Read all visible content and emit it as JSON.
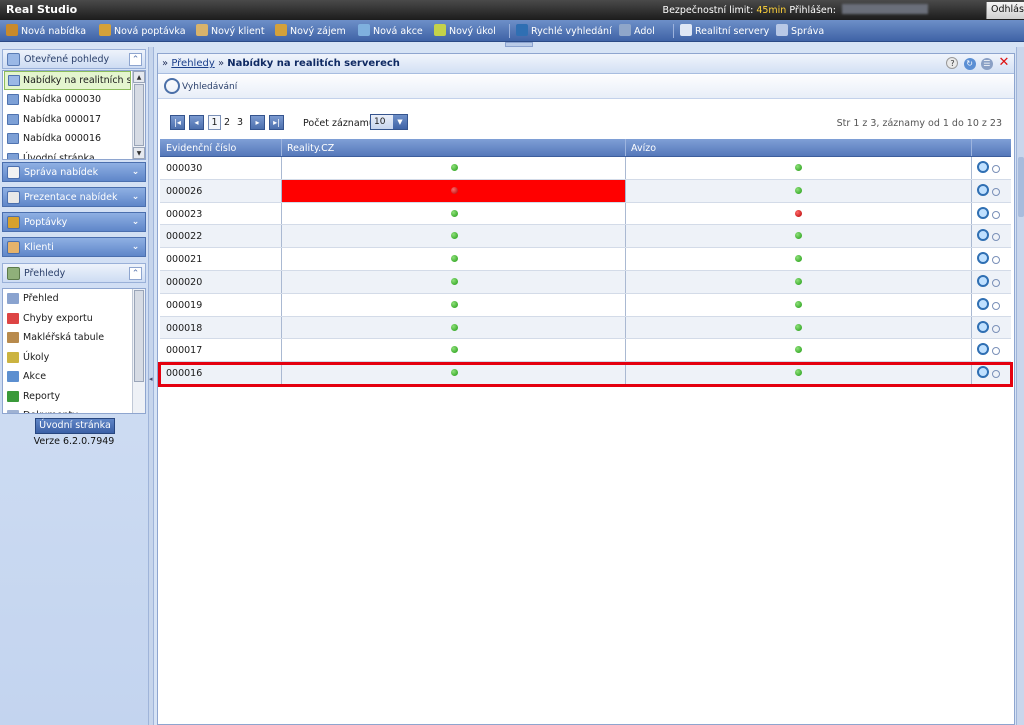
{
  "app": {
    "title": "Real Studio",
    "security_label": "Bezpečnostní limit:",
    "security_time": "45min",
    "logged_label": "Přihlášen:",
    "logout_label": "Odhlás"
  },
  "toolbar": {
    "items": [
      {
        "label": "Nová nabídka",
        "icon": "house-add-icon",
        "color": "#c98a2b"
      },
      {
        "label": "Nová poptávka",
        "icon": "house-query-icon",
        "color": "#d4a13a"
      },
      {
        "label": "Nový klient",
        "icon": "people-icon",
        "color": "#d9b36b"
      },
      {
        "label": "Nový zájem",
        "icon": "key-icon",
        "color": "#d4a13a"
      },
      {
        "label": "Nová akce",
        "icon": "calendar-add-icon",
        "color": "#7fb0de"
      },
      {
        "label": "Nový úkol",
        "icon": "task-add-icon",
        "color": "#c4d24a"
      },
      {
        "label": "Rychlé vyhledání",
        "icon": "search-icon",
        "color": "#2f6fb3"
      },
      {
        "label": "Adol",
        "icon": "gear-icon",
        "color": "#8fa6c9"
      },
      {
        "label": "Realitní servery",
        "icon": "server-icon",
        "color": "#dfe7f5"
      },
      {
        "label": "Správa",
        "icon": "settings-icon",
        "color": "#b8c8e6"
      }
    ]
  },
  "sidebar": {
    "open_views": {
      "header": "Otevřené pohledy",
      "items": [
        {
          "label": "Nabídky na realitních serv",
          "selected": true
        },
        {
          "label": "Nabídka 000030"
        },
        {
          "label": "Nabídka 000017"
        },
        {
          "label": "Nabídka 000016"
        },
        {
          "label": "Úvodní stránka"
        }
      ]
    },
    "sections": [
      {
        "label": "Správa nabídek",
        "icon": "house-icon",
        "color": "#f2f2f2"
      },
      {
        "label": "Prezentace nabídek",
        "icon": "presentation-icon",
        "color": "#e8e8e8"
      },
      {
        "label": "Poptávky",
        "icon": "query-icon",
        "color": "#d7a12e"
      },
      {
        "label": "Klienti",
        "icon": "clients-icon",
        "color": "#e6b36b"
      }
    ],
    "overviews": {
      "header": "Přehledy",
      "items": [
        {
          "label": "Přehled",
          "icon": "overview-icon",
          "color": "#8aa3cf"
        },
        {
          "label": "Chyby exportu",
          "icon": "export-error-icon",
          "color": "#d44"
        },
        {
          "label": "Makléřská tabule",
          "icon": "board-icon",
          "color": "#b88a4c"
        },
        {
          "label": "Úkoly",
          "icon": "tasks-icon",
          "color": "#cbb340"
        },
        {
          "label": "Akce",
          "icon": "actions-icon",
          "color": "#5c8fd0"
        },
        {
          "label": "Reporty",
          "icon": "reports-icon",
          "color": "#3a9a3a"
        },
        {
          "label": "Dokumenty",
          "icon": "documents-icon",
          "color": "#9fb2d3"
        }
      ]
    },
    "home_button": "Úvodní stránka",
    "version": "Verze 6.2.0.7949"
  },
  "main": {
    "breadcrumb_prefix": "»",
    "breadcrumb_link": "Přehledy",
    "breadcrumb_sep": "»",
    "title": "Nabídky na realitích serverech",
    "search_label": "Vyhledávání",
    "pager": {
      "pages": [
        "1",
        "2",
        "3"
      ],
      "current": "1",
      "records_label": "Počet záznamů",
      "records_value": "10",
      "info": "Str 1 z 3, záznamy od 1 do 10 z 23"
    },
    "grid": {
      "columns": [
        "Evidenční číslo",
        "Reality.CZ",
        "Avízo",
        ""
      ],
      "rows": [
        {
          "id": "000030",
          "reality": "ok",
          "avizo": "ok"
        },
        {
          "id": "000026",
          "reality": "error",
          "avizo": "ok"
        },
        {
          "id": "000023",
          "reality": "ok",
          "avizo": "error"
        },
        {
          "id": "000022",
          "reality": "ok",
          "avizo": "ok"
        },
        {
          "id": "000021",
          "reality": "ok",
          "avizo": "ok"
        },
        {
          "id": "000020",
          "reality": "ok",
          "avizo": "ok"
        },
        {
          "id": "000019",
          "reality": "ok",
          "avizo": "ok"
        },
        {
          "id": "000018",
          "reality": "ok",
          "avizo": "ok"
        },
        {
          "id": "000017",
          "reality": "ok",
          "avizo": "ok"
        },
        {
          "id": "000016",
          "reality": "ok",
          "avizo": "ok"
        }
      ],
      "highlighted_row": "000016"
    }
  }
}
